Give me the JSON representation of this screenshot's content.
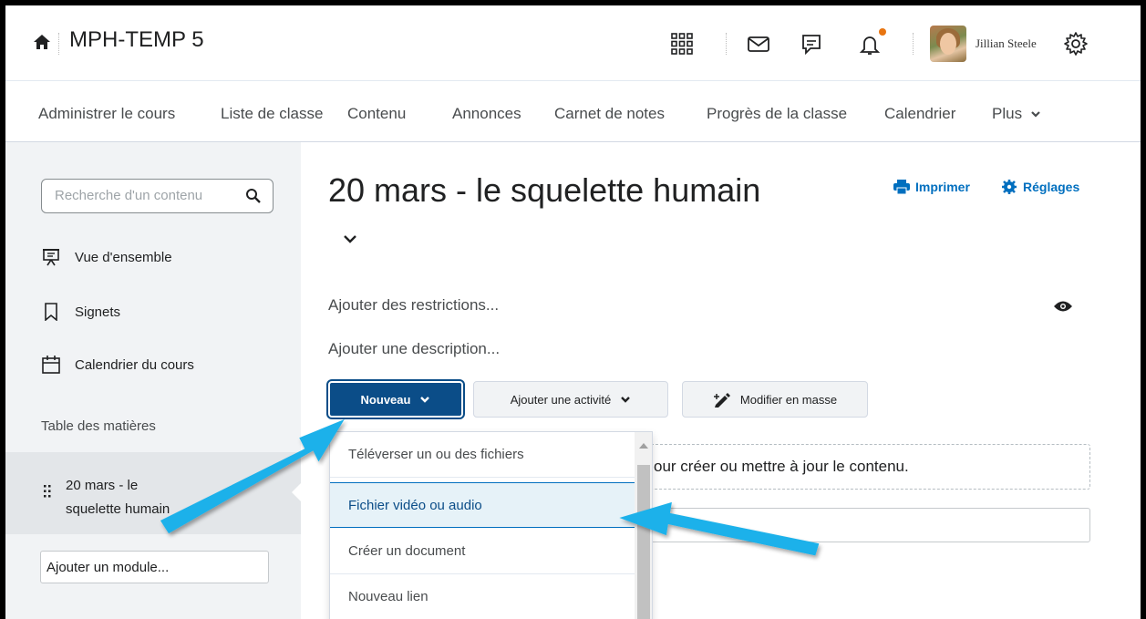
{
  "header": {
    "course_title": "MPH-TEMP 5",
    "user_name": "Jillian Steele"
  },
  "nav": {
    "items": [
      "Administrer le cours",
      "Liste de classe",
      "Contenu",
      "Annonces",
      "Carnet de notes",
      "Progrès de la classe",
      "Calendrier",
      "Plus"
    ]
  },
  "sidebar": {
    "search_placeholder": "Recherche d'un contenu",
    "links": [
      "Vue d'ensemble",
      "Signets",
      "Calendrier du cours"
    ],
    "toc_header": "Table des matières",
    "toc_item": "20 mars - le squelette humain",
    "add_module": "Ajouter un module..."
  },
  "main": {
    "title": "20 mars - le squelette humain",
    "print_label": "Imprimer",
    "settings_label": "Réglages",
    "add_restrictions": "Ajouter des restrictions...",
    "add_description": "Ajouter une description...",
    "new_button": "Nouveau",
    "add_activity_button": "Ajouter une activité",
    "bulk_edit_button": "Modifier en masse",
    "dropzone_text": "our créer ou mettre à jour le contenu."
  },
  "menu": {
    "items": [
      "Téléverser un ou des fichiers",
      "Fichier vidéo ou audio",
      "Créer un document",
      "Nouveau lien"
    ],
    "active_index": 1
  },
  "colors": {
    "primary": "#0b4d88",
    "link": "#006fbf",
    "annotation_arrow": "#1ab1ea",
    "notification_dot": "#e87511"
  }
}
